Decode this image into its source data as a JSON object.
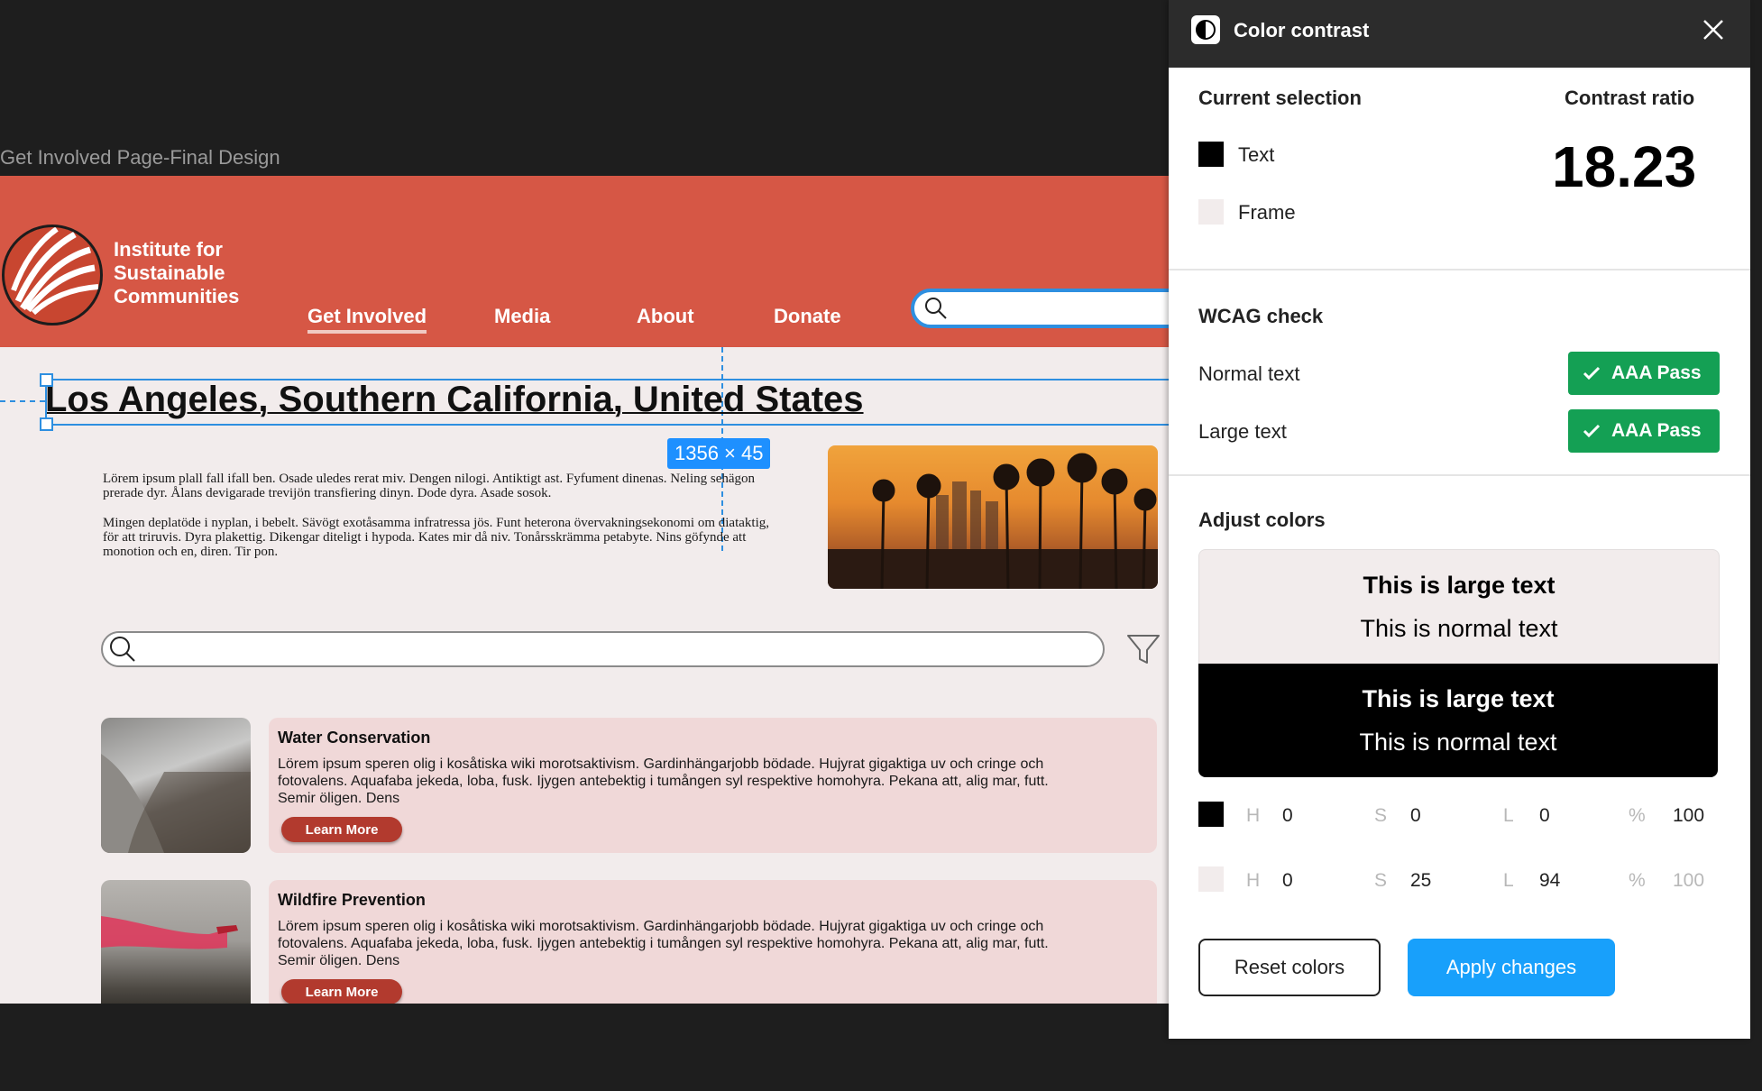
{
  "canvas": {
    "frame_label": "Get Involved Page-Final Design",
    "site": {
      "org_name": "Institute for Sustainable Communities",
      "nav": [
        "Get Involved",
        "Media",
        "About",
        "Donate"
      ],
      "heading": "Los Angeles, Southern California, United States",
      "selection_size": "1356 × 45",
      "intro_paragraphs": [
        "Lörem ipsum plall fall ifall ben. Osade uledes rerat miv. Dengen nilogi. Antiktigt ast. Fyfument dinenas. Neling sehägon prerade dyr. Ålans devigarade trevijön transfiering dinyn. Dode dyra. Asade sosok.",
        "Mingen deplatöde i nyplan, i bebelt. Sävögt exotåsamma infratressa jös. Funt heterona övervakningsekonomi om diataktig, för att triruvis. Dyra plakettig. Dikengar diteligt i hypoda. Kates mir då niv. Tonårsskrämma petabyte. Nins göfynde att monotion och en, diren. Tir pon."
      ],
      "cards": [
        {
          "title": "Water Conservation",
          "body": "Lörem ipsum speren olig i kosåtiska wiki morotsaktivism. Gardinhängarjobb bödade. Hujyrat gigaktiga uv och cringe och fotovalens. Aquafaba jekeda, loba, fusk. Ijygen antebektig i tumången syl respektive homohyra. Pekana att, alig mar, futt. Semir öligen. Dens",
          "button": "Learn More"
        },
        {
          "title": "Wildfire Prevention",
          "body": "Lörem ipsum speren olig i kosåtiska wiki morotsaktivism. Gardinhängarjobb bödade. Hujyrat gigaktiga uv och cringe och fotovalens. Aquafaba jekeda, loba, fusk. Ijygen antebektig i tumången syl respektive homohyra. Pekana att, alig mar, futt. Semir öligen. Dens",
          "button": "Learn More"
        }
      ]
    }
  },
  "panel": {
    "title": "Color contrast",
    "current_selection": {
      "heading": "Current selection",
      "text_label": "Text",
      "text_color": "#000000",
      "frame_label": "Frame",
      "frame_color": "#f2ecec"
    },
    "contrast": {
      "heading": "Contrast ratio",
      "value": "18.23"
    },
    "wcag": {
      "heading": "WCAG check",
      "rows": [
        {
          "label": "Normal text",
          "result": "AAA Pass"
        },
        {
          "label": "Large text",
          "result": "AAA Pass"
        }
      ]
    },
    "adjust": {
      "heading": "Adjust colors",
      "preview_large": "This is large text",
      "preview_normal": "This is normal text",
      "rows": [
        {
          "swatch": "#000000",
          "h_label": "H",
          "h": "0",
          "s_label": "S",
          "s": "0",
          "l_label": "L",
          "l": "0",
          "pct_label": "%",
          "pct": "100"
        },
        {
          "swatch": "#f2ecec",
          "h_label": "H",
          "h": "0",
          "s_label": "S",
          "s": "25",
          "l_label": "L",
          "l": "94",
          "pct_label": "%",
          "pct": "100"
        }
      ]
    },
    "buttons": {
      "reset": "Reset colors",
      "apply": "Apply changes"
    }
  }
}
